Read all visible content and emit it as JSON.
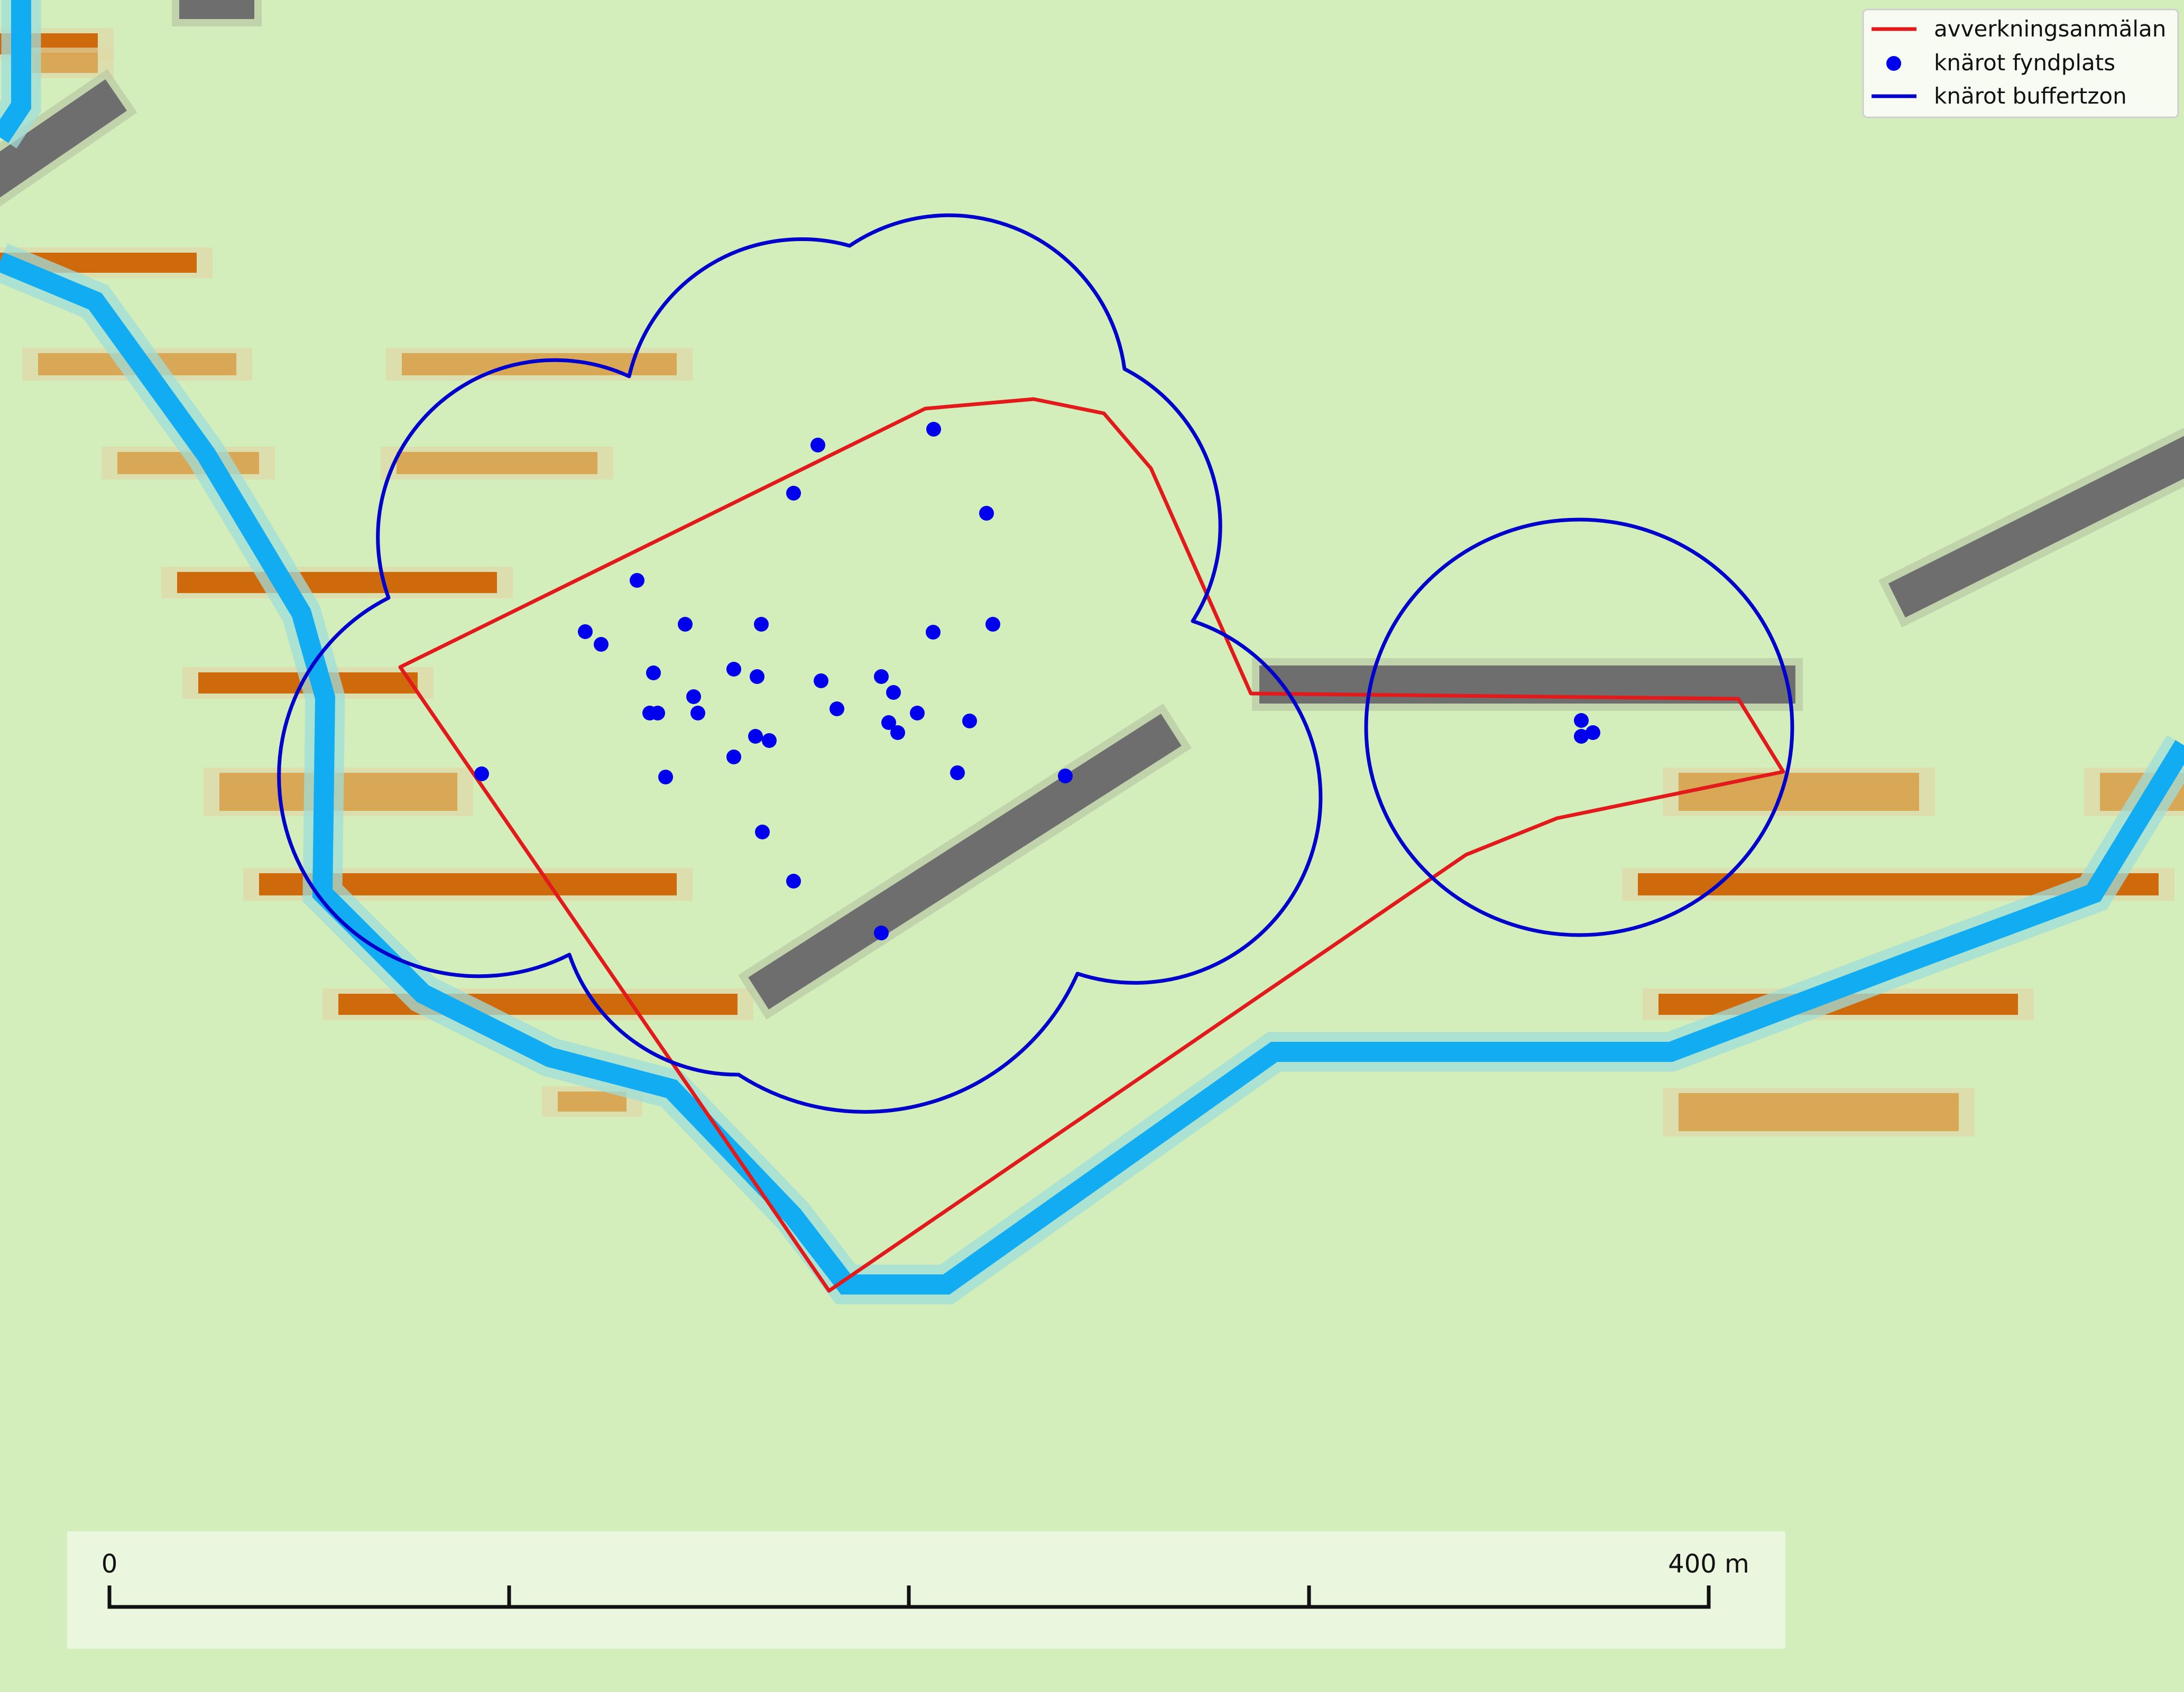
{
  "legend": {
    "items": [
      {
        "label": "avverkningsanmälan",
        "symbol": "line",
        "color": "#e31a1c"
      },
      {
        "label": "knärot fyndplats",
        "symbol": "point",
        "color": "#0000ee"
      },
      {
        "label": "knärot buffertzon",
        "symbol": "line",
        "color": "#0000cc"
      }
    ]
  },
  "scale_bar": {
    "start_label": "0",
    "end_label": "400 m",
    "length_m": 400,
    "ticks": 5
  },
  "colors": {
    "background": "#d3eebb",
    "felling_area": "#e31a1c",
    "finds": "#0000ee",
    "buffer": "#0000cc",
    "stream": "#12acf3",
    "road": "#6e6e6e",
    "contour_dark": "#cf6a0c",
    "contour_light": "#d8a24e"
  },
  "layers": [
    "background-terrain",
    "streams",
    "roads",
    "contours",
    "felling-area",
    "buffer-zone",
    "find-points",
    "legend",
    "scale-bar"
  ]
}
